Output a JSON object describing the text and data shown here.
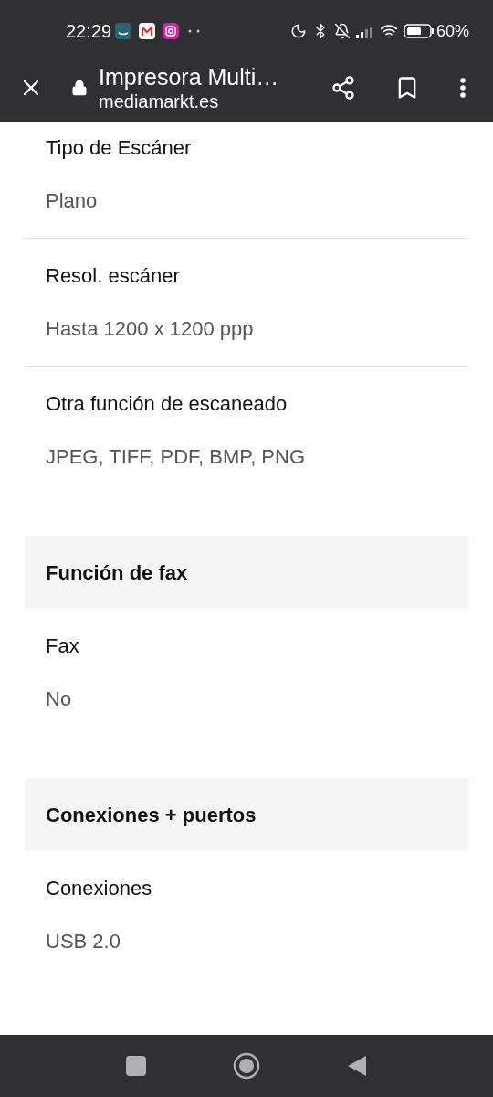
{
  "status_bar": {
    "time": "22:29",
    "battery": "60%"
  },
  "toolbar": {
    "title": "Impresora Multi…",
    "url": "mediamarkt.es"
  },
  "sections": [
    {
      "rows": [
        {
          "label": "Tipo de Escáner",
          "value": "Plano"
        },
        {
          "label": "Resol. escáner",
          "value": "Hasta 1200 x 1200 ppp"
        },
        {
          "label": "Otra función de escaneado",
          "value": "JPEG, TIFF, PDF, BMP, PNG"
        }
      ]
    },
    {
      "header": "Función de fax",
      "rows": [
        {
          "label": "Fax",
          "value": "No"
        }
      ]
    },
    {
      "header": "Conexiones + puertos",
      "rows": [
        {
          "label": "Conexiones",
          "value": "USB 2.0"
        }
      ]
    }
  ]
}
